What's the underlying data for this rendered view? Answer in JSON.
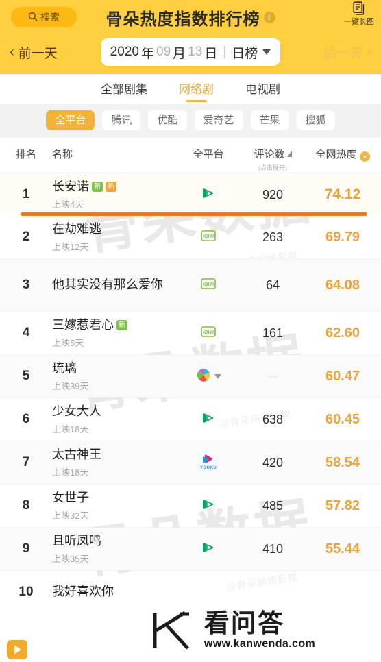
{
  "header": {
    "search_label": "搜索",
    "search_icon": "search-icon",
    "title": "骨朵热度指数排行榜",
    "info_icon": "info-icon",
    "longpic_label": "一键长图",
    "longpic_icon": "document-stack-icon",
    "prev_day": "前一天",
    "next_day": "后一天",
    "date": {
      "year": "2020",
      "year_unit": "年",
      "month": "09",
      "month_unit": "月",
      "day": "13",
      "day_unit": "日",
      "period": "日榜"
    },
    "accent_color": "#ffcf3f",
    "pill_color": "#fdb913"
  },
  "tabs": [
    {
      "label": "全部剧集",
      "active": false
    },
    {
      "label": "网络剧",
      "active": true
    },
    {
      "label": "电视剧",
      "active": false
    }
  ],
  "platforms": [
    {
      "label": "全平台",
      "active": true
    },
    {
      "label": "腾讯",
      "active": false
    },
    {
      "label": "优酷",
      "active": false
    },
    {
      "label": "爱奇艺",
      "active": false
    },
    {
      "label": "芒果",
      "active": false
    },
    {
      "label": "搜狐",
      "active": false
    }
  ],
  "table": {
    "columns": {
      "rank": "排名",
      "name": "名称",
      "platform": "全平台",
      "comments": "评论数",
      "comments_hint": "(点击展开)",
      "heat": "全网热度"
    },
    "rows": [
      {
        "rank": "1",
        "title": "长安诺",
        "badges": [
          {
            "text": "新",
            "type": "new"
          },
          {
            "text": "热",
            "type": "hot"
          }
        ],
        "sub": "上映4天",
        "platform_icon": "tencent-video-icon",
        "comments": "920",
        "heat": "74.12",
        "progress": true
      },
      {
        "rank": "2",
        "title": "在劫难逃",
        "badges": [],
        "sub": "上映12天",
        "platform_icon": "iqiyi-icon",
        "comments": "263",
        "heat": "69.79",
        "progress": false
      },
      {
        "rank": "3",
        "title": "他其实没有那么爱你",
        "badges": [],
        "sub": "",
        "platform_icon": "iqiyi-icon",
        "comments": "64",
        "heat": "64.08",
        "progress": false
      },
      {
        "rank": "4",
        "title": "三嫁惹君心",
        "badges": [
          {
            "text": "新",
            "type": "new"
          }
        ],
        "sub": "上映5天",
        "platform_icon": "iqiyi-icon",
        "comments": "161",
        "heat": "62.60",
        "progress": false
      },
      {
        "rank": "5",
        "title": "琉璃",
        "badges": [],
        "sub": "上映39天",
        "platform_icon": "multi-platform-icon",
        "comments": "---",
        "heat": "60.47",
        "progress": false
      },
      {
        "rank": "6",
        "title": "少女大人",
        "badges": [],
        "sub": "上映18天",
        "platform_icon": "tencent-video-icon",
        "comments": "638",
        "heat": "60.45",
        "progress": false
      },
      {
        "rank": "7",
        "title": "太古神王",
        "badges": [],
        "sub": "上映18天",
        "platform_icon": "youku-icon",
        "comments": "420",
        "heat": "58.54",
        "progress": false
      },
      {
        "rank": "8",
        "title": "女世子",
        "badges": [],
        "sub": "上映32天",
        "platform_icon": "tencent-video-icon",
        "comments": "485",
        "heat": "57.82",
        "progress": false
      },
      {
        "rank": "9",
        "title": "且听凤鸣",
        "badges": [],
        "sub": "上映35天",
        "platform_icon": "tencent-video-icon",
        "comments": "410",
        "heat": "55.44",
        "progress": false
      },
      {
        "rank": "10",
        "title": "我好喜欢你",
        "badges": [],
        "sub": "",
        "platform_icon": "",
        "comments": "",
        "heat": "",
        "progress": false
      }
    ]
  },
  "watermarks": {
    "brand_big": "骨朵数据",
    "brand_small": "@骨朵网络影视"
  },
  "overlay": {
    "logo_icon": "kanwenda-logo-icon",
    "brand_cn": "看问答",
    "url": "www.kanwenda.com"
  },
  "fab": {
    "icon": "play-button-icon"
  }
}
